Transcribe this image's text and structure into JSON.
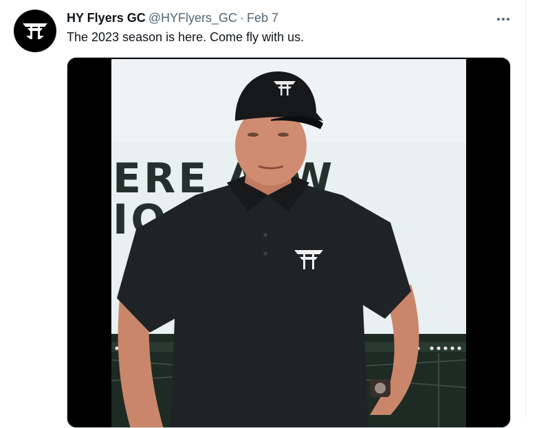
{
  "tweet": {
    "display_name": "HY Flyers GC",
    "handle": "@HYFlyers_GC",
    "separator": "·",
    "date": "Feb 7",
    "text": "The 2023 season is here. Come fly with us.",
    "more_icon": "more-horizontal-icon",
    "avatar_icon": "hy-flyers-logo"
  },
  "media": {
    "backdrop_line1": "ERE  ALW",
    "backdrop_line2": "IO    LE"
  },
  "colors": {
    "text": "#0f1419",
    "secondary": "#536471",
    "backdrop_text": "#24302c",
    "screen": "#e9f0f1",
    "shirt": "#202325"
  }
}
